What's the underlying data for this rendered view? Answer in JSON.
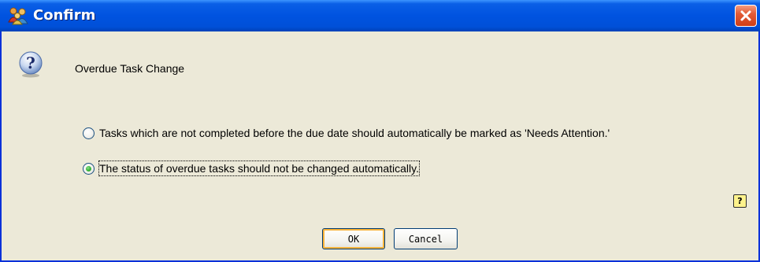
{
  "window": {
    "title": "Confirm",
    "close_icon": "close-icon",
    "title_icon": "app-people-icon"
  },
  "dialog": {
    "icon": "question-icon",
    "heading": "Overdue Task Change",
    "options": [
      {
        "label": "Tasks which are not completed before the due date should automatically be marked as 'Needs Attention.'",
        "selected": false
      },
      {
        "label": "The status of overdue tasks should not be changed automatically.",
        "selected": true
      }
    ],
    "help_label": "?"
  },
  "buttons": {
    "ok_label": "OK",
    "cancel_label": "Cancel"
  },
  "colors": {
    "titlebar": "#0053e0",
    "background": "#ece9d8",
    "close_button": "#e25b36",
    "radio_selected": "#3cb83c",
    "default_button_highlight": "#f8b33a"
  }
}
